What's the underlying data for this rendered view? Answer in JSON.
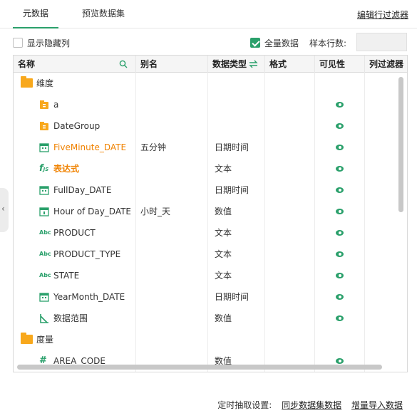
{
  "tabs": {
    "meta": "元数据",
    "preview": "预览数据集"
  },
  "edit_filter": "编辑行过滤器",
  "options": {
    "show_hidden": "显示隐藏列",
    "full_data": "全量数据",
    "sample_rows": "样本行数:"
  },
  "table": {
    "headers": [
      "名称",
      "别名",
      "数据类型",
      "格式",
      "可见性",
      "列过滤器"
    ],
    "groups": {
      "dimension": "维度",
      "measure": "度量"
    },
    "rows": [
      {
        "name": "a",
        "alias": "",
        "dtype": "",
        "icon": "folder-doc-icon"
      },
      {
        "name": "DateGroup",
        "alias": "",
        "dtype": "",
        "icon": "folder-doc-icon"
      },
      {
        "name": "FiveMinute_DATE",
        "alias": "五分钟",
        "dtype": "日期时间",
        "icon": "calendar-icon"
      },
      {
        "name": "表达式",
        "alias": "",
        "dtype": "文本",
        "icon": "function-icon"
      },
      {
        "name": "FullDay_DATE",
        "alias": "",
        "dtype": "日期时间",
        "icon": "calendar-icon"
      },
      {
        "name": "Hour of Day_DATE",
        "alias": "小时_天",
        "dtype": "数值",
        "icon": "calendar-icon"
      },
      {
        "name": "PRODUCT",
        "alias": "",
        "dtype": "文本",
        "icon": "abc-icon"
      },
      {
        "name": "PRODUCT_TYPE",
        "alias": "",
        "dtype": "文本",
        "icon": "abc-icon"
      },
      {
        "name": "STATE",
        "alias": "",
        "dtype": "文本",
        "icon": "abc-icon"
      },
      {
        "name": "YearMonth_DATE",
        "alias": "",
        "dtype": "日期时间",
        "icon": "calendar-icon"
      },
      {
        "name": "数据范围",
        "alias": "",
        "dtype": "数值",
        "icon": "range-icon"
      }
    ],
    "measure_rows": [
      {
        "name": "AREA_CODE",
        "alias": "",
        "dtype": "数值",
        "icon": "hash-icon"
      }
    ]
  },
  "footer": {
    "label": "定时抽取设置:",
    "sync_link": "同步数据集数据",
    "import_link": "增量导入数据"
  },
  "colors": {
    "accent": "#2aa06b",
    "orange": "#f08200",
    "folder": "#f8a81c"
  }
}
